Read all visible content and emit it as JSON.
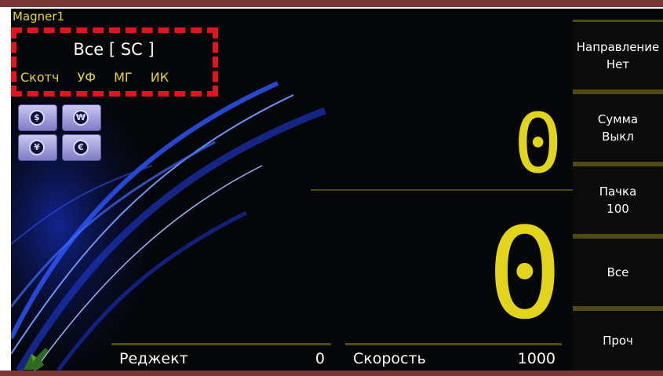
{
  "brand": "Magner1",
  "mode": {
    "title": "Все [ SC ]",
    "features": [
      "Скотч",
      "УФ",
      "МГ",
      "ИК"
    ]
  },
  "currency_icons": [
    {
      "name": "dollar-icon",
      "glyph": "$"
    },
    {
      "name": "won-icon",
      "glyph": "₩"
    },
    {
      "name": "yen-icon",
      "glyph": "¥"
    },
    {
      "name": "euro-icon",
      "glyph": "€"
    }
  ],
  "counters": {
    "upper": "0",
    "lower": "0"
  },
  "sidebar": {
    "direction": {
      "line1": "Направление",
      "line2": "Нет"
    },
    "sum": {
      "line1": "Сумма",
      "line2": "Выкл"
    },
    "batch": {
      "line1": "Пачка",
      "line2": "100"
    },
    "all": {
      "line1": "Все"
    },
    "other": {
      "line1": "Проч"
    }
  },
  "status": {
    "reject_label": "Реджект",
    "reject_value": "0",
    "speed_label": "Скорость",
    "speed_value": "1000"
  },
  "colors": {
    "accent_yellow": "#e2d31d",
    "highlight_red": "#e0161e",
    "frame_bar": "#7a3536",
    "screen_bg": "#050608"
  }
}
